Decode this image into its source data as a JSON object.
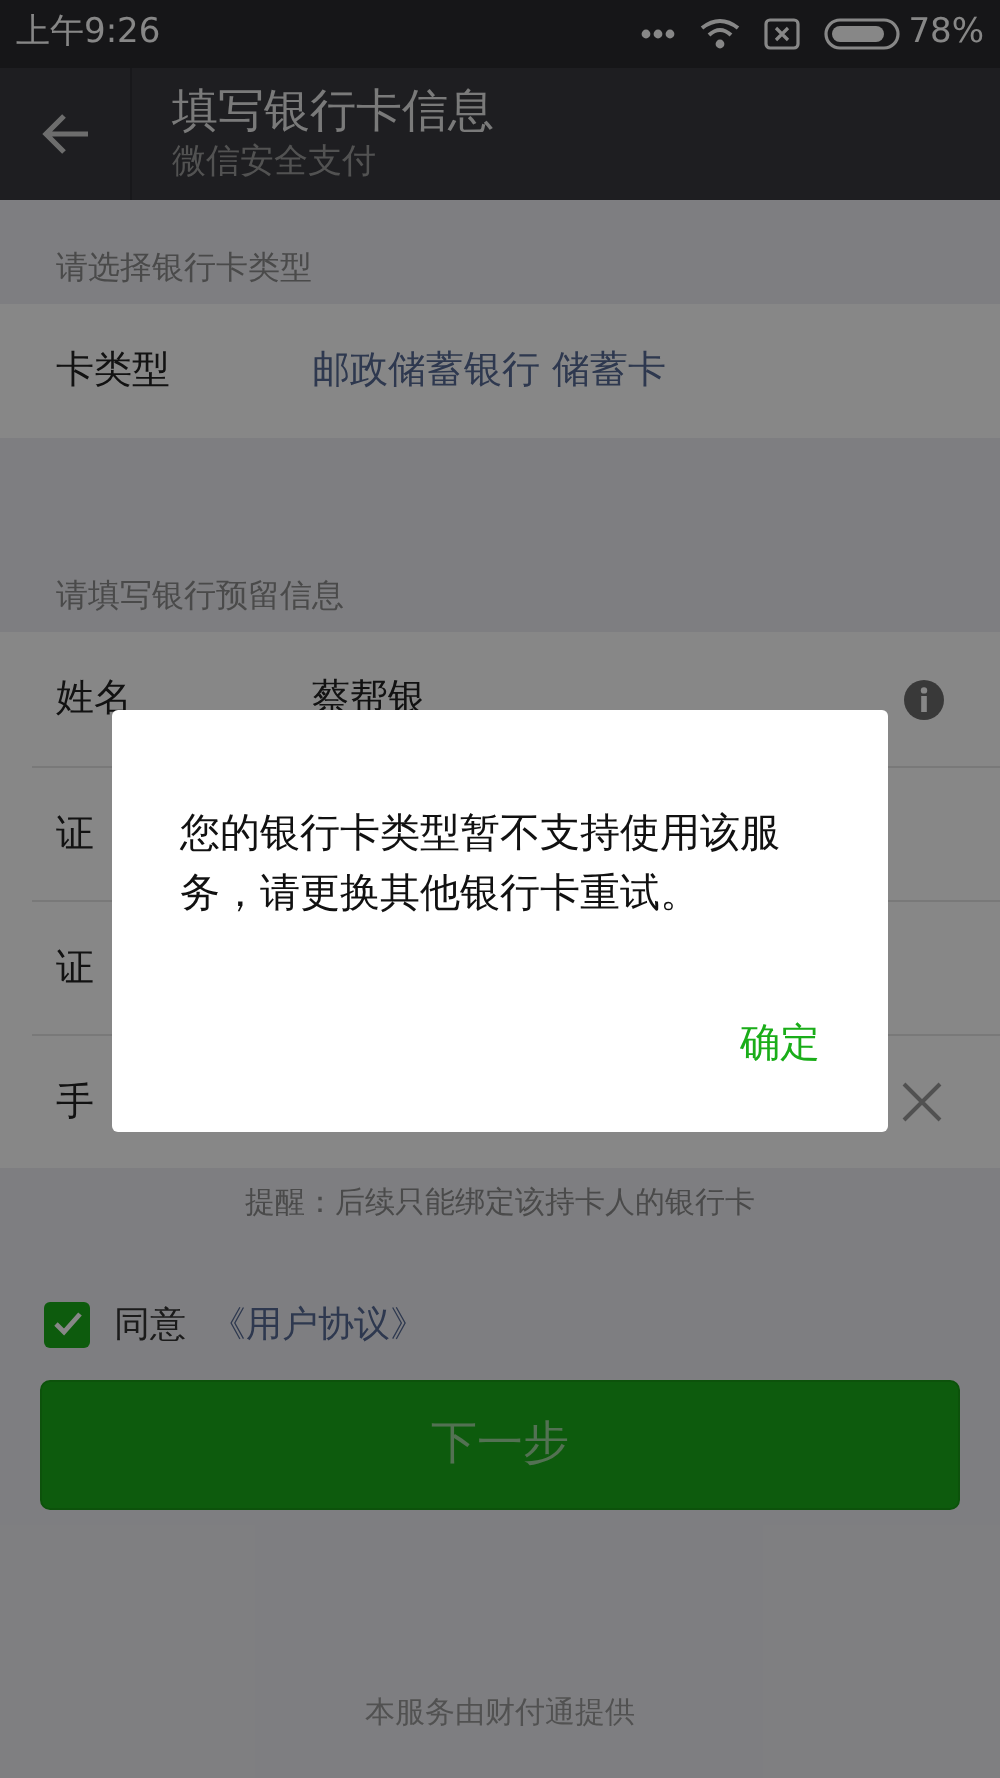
{
  "status_bar": {
    "time": "上午9:26",
    "battery": "78%"
  },
  "header": {
    "title": "填写银行卡信息",
    "subtitle": "微信安全支付"
  },
  "sections": [
    {
      "label": "请选择银行卡类型",
      "rows": [
        {
          "label": "卡类型",
          "value": "邮政储蓄银行 储蓄卡",
          "kind": "link"
        }
      ]
    },
    {
      "label": "请填写银行预留信息",
      "rows": [
        {
          "label": "姓名",
          "value": "蔡帮银",
          "kind": "info"
        },
        {
          "label": "证",
          "kind": "plain"
        },
        {
          "label": "证",
          "kind": "plain"
        },
        {
          "label": "手",
          "kind": "clear"
        }
      ]
    }
  ],
  "reminder": "提醒：后续只能绑定该持卡人的银行卡",
  "agreement": {
    "checked": true,
    "label": "同意",
    "link": "《用户协议》"
  },
  "next_button": {
    "label": "下一步"
  },
  "footer": "本服务由财付通提供",
  "dialog": {
    "message": "您的银行卡类型暂不支持使用该服务，请更换其他银行卡重试。",
    "confirm": "确定"
  }
}
